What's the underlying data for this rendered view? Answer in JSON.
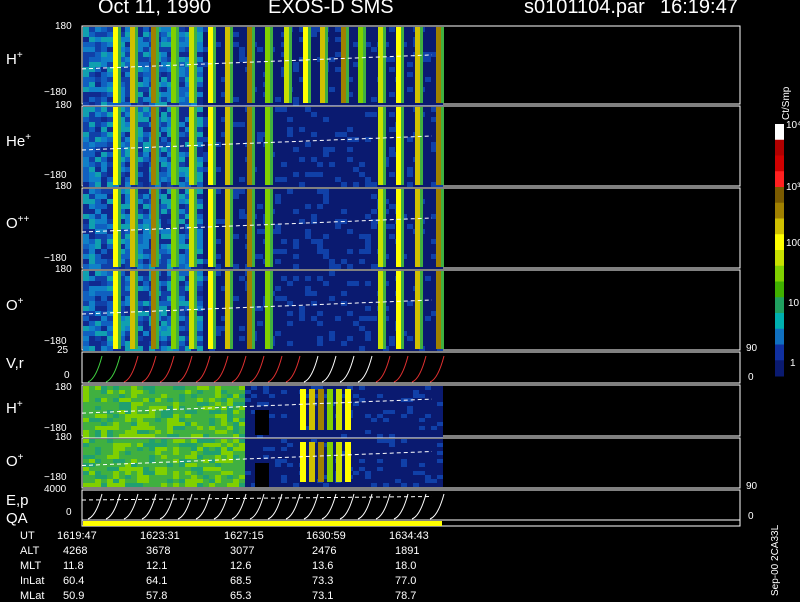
{
  "header": {
    "date": "Oct 11, 1990",
    "instrument": "EXOS-D SMS",
    "file": "s0101104.par",
    "time": "16:19:47"
  },
  "colorbar": {
    "label": "Ct/Smp",
    "ticks": [
      "10⁴",
      "10³",
      "100",
      "10",
      "1"
    ],
    "colors": [
      "#ffffff",
      "#b00000",
      "#d00000",
      "#ff2020",
      "#7a5a00",
      "#a08000",
      "#d0c000",
      "#ffff00",
      "#c8e000",
      "#80d000",
      "#40b000",
      "#20a060",
      "#00b0b0",
      "#1070c0",
      "#1030a0",
      "#0a1a70"
    ]
  },
  "panels": [
    {
      "name": "H",
      "sup": "+",
      "ymax": "180",
      "ymin": "−180"
    },
    {
      "name": "He",
      "sup": "+",
      "ymax": "180",
      "ymin": "−180"
    },
    {
      "name": "O",
      "sup": "++",
      "ymax": "180",
      "ymin": "−180"
    },
    {
      "name": "O",
      "sup": "+",
      "ymax": "180",
      "ymin": "−180"
    },
    {
      "name": "V,r",
      "sup": "",
      "ymax": "25",
      "ymin": "0",
      "right_top": "90",
      "right_bottom": "0"
    },
    {
      "name": "H",
      "sup": "+",
      "ymax": "180",
      "ymin": "−180"
    },
    {
      "name": "O",
      "sup": "+",
      "ymax": "180",
      "ymin": "−180"
    },
    {
      "name": "E,p",
      "sup": "",
      "ymax": "4000",
      "ymin": "0",
      "right_top": "90",
      "right_bottom": "0"
    },
    {
      "name": "QA",
      "sup": "",
      "ymax": "",
      "ymin": ""
    }
  ],
  "side_note": "Sep-00 2CA33L",
  "footer": {
    "rows": [
      {
        "label": "UT",
        "values": [
          "1619:47",
          "1623:31",
          "1627:15",
          "1630:59",
          "1634:43"
        ]
      },
      {
        "label": "ALT",
        "values": [
          "4268",
          "3678",
          "3077",
          "2476",
          "1891"
        ]
      },
      {
        "label": "MLT",
        "values": [
          "11.8",
          "12.1",
          "12.6",
          "13.6",
          "18.0"
        ]
      },
      {
        "label": "InLat",
        "values": [
          "60.4",
          "64.1",
          "68.5",
          "73.3",
          "77.0"
        ]
      },
      {
        "label": "MLat",
        "values": [
          "50.9",
          "57.8",
          "65.3",
          "73.1",
          "78.7"
        ]
      }
    ]
  },
  "chart_data": {
    "type": "heatmap",
    "x_label": "UT",
    "x_ticks": [
      "1619:47",
      "1623:31",
      "1627:15",
      "1630:59",
      "1634:43"
    ],
    "data_fraction_of_x": 0.545,
    "colorscale": [
      "1",
      "10",
      "100",
      "10³",
      "10⁴"
    ],
    "series": [
      {
        "name": "H⁺",
        "ylim": [
          -180,
          180
        ]
      },
      {
        "name": "He⁺",
        "ylim": [
          -180,
          180
        ]
      },
      {
        "name": "O⁺⁺",
        "ylim": [
          -180,
          180
        ]
      },
      {
        "name": "O⁺",
        "ylim": [
          -180,
          180
        ]
      },
      {
        "name": "V,r",
        "ylim": [
          0,
          25
        ]
      },
      {
        "name": "H⁺",
        "ylim": [
          -180,
          180
        ]
      },
      {
        "name": "O⁺",
        "ylim": [
          -180,
          180
        ]
      },
      {
        "name": "E,p",
        "ylim": [
          0,
          4000
        ]
      },
      {
        "name": "QA"
      }
    ]
  }
}
